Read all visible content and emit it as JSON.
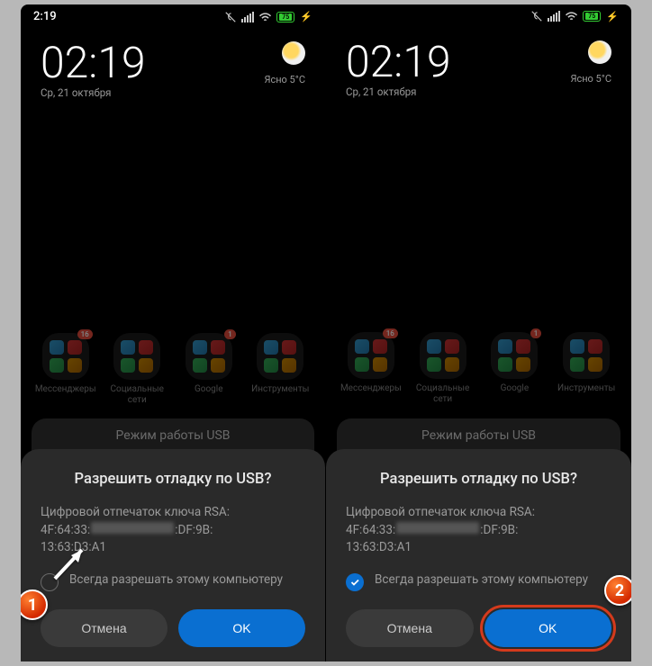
{
  "status": {
    "time": "2:19",
    "battery": "75"
  },
  "home": {
    "clock_time": "02:19",
    "clock_date": "Ср, 21 октября",
    "weather_text": "Ясно  5°C"
  },
  "folders": [
    {
      "label": "Мессенджеры",
      "badge": "16"
    },
    {
      "label": "Социальные сети",
      "badge": ""
    },
    {
      "label": "Google",
      "badge": "1"
    },
    {
      "label": "Инструменты",
      "badge": ""
    }
  ],
  "sheet_behind_text": "Режим работы USB",
  "dialog": {
    "title": "Разрешить отладку по USB?",
    "fingerprint_label": "Цифровой отпечаток ключа RSA:",
    "fp_part1": "4F:64:33:",
    "fp_part2": ":DF:9B:",
    "fp_part3": "13:63:D3:A1",
    "always_label": "Всегда разрешать этому компьютеру",
    "cancel": "Отмена",
    "ok": "OK"
  },
  "steps": {
    "one": "1",
    "two": "2"
  },
  "colors": {
    "accent": "#0a6fd1",
    "callout": "#d42a00"
  }
}
